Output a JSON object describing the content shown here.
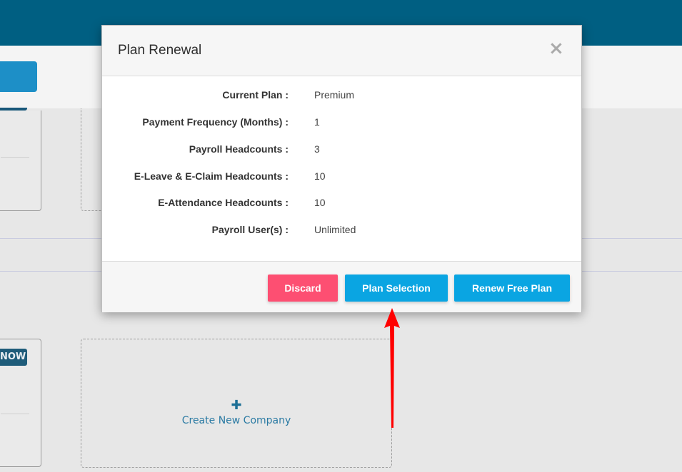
{
  "background": {
    "now_tag": "NOW",
    "create_company_label": "Create New Company",
    "create_company_icon": "plus-icon"
  },
  "modal": {
    "title": "Plan Renewal",
    "close_icon": "close-icon",
    "fields": [
      {
        "label": "Current Plan :",
        "value": "Premium"
      },
      {
        "label": "Payment Frequency (Months) :",
        "value": "1"
      },
      {
        "label": "Payroll Headcounts :",
        "value": "3"
      },
      {
        "label": "E-Leave & E-Claim Headcounts :",
        "value": "10"
      },
      {
        "label": "E-Attendance Headcounts :",
        "value": "10"
      },
      {
        "label": "Payroll User(s) :",
        "value": "Unlimited"
      }
    ],
    "buttons": {
      "discard": "Discard",
      "plan_selection": "Plan Selection",
      "renew_free_plan": "Renew Free Plan"
    }
  },
  "colors": {
    "topbar": "#005f82",
    "discard": "#fd4f72",
    "primary": "#0aa5e2",
    "annotation_arrow": "#ff0000"
  }
}
